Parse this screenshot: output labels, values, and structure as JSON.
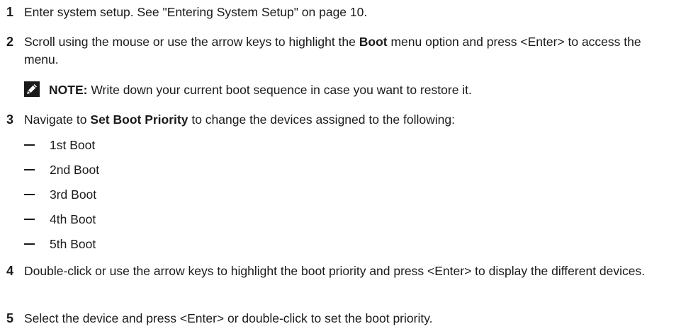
{
  "steps": [
    {
      "number": "1",
      "text": "Enter system setup. See \"Entering System Setup\" on page 10."
    },
    {
      "number": "2",
      "text_before": "Scroll using the mouse or use the arrow keys to highlight the ",
      "bold": "Boot",
      "text_after": " menu option and press <Enter> to access the menu."
    },
    {
      "number": "3",
      "text_before": "Navigate to ",
      "bold": "Set Boot Priority",
      "text_after": " to change the devices assigned to the following:"
    },
    {
      "number": "4",
      "text": "Double-click or use the arrow keys to highlight the boot priority and press <Enter> to display the different devices."
    },
    {
      "number": "5",
      "text": "Select the device and press <Enter> or double-click to set the boot priority."
    }
  ],
  "note": {
    "label": "NOTE:",
    "text": " Write down your current boot sequence in case you want to restore it.",
    "icon": "pencil-note-icon"
  },
  "boot_items": [
    "1st Boot",
    "2nd Boot",
    "3rd Boot",
    "4th Boot",
    "5th Boot"
  ]
}
